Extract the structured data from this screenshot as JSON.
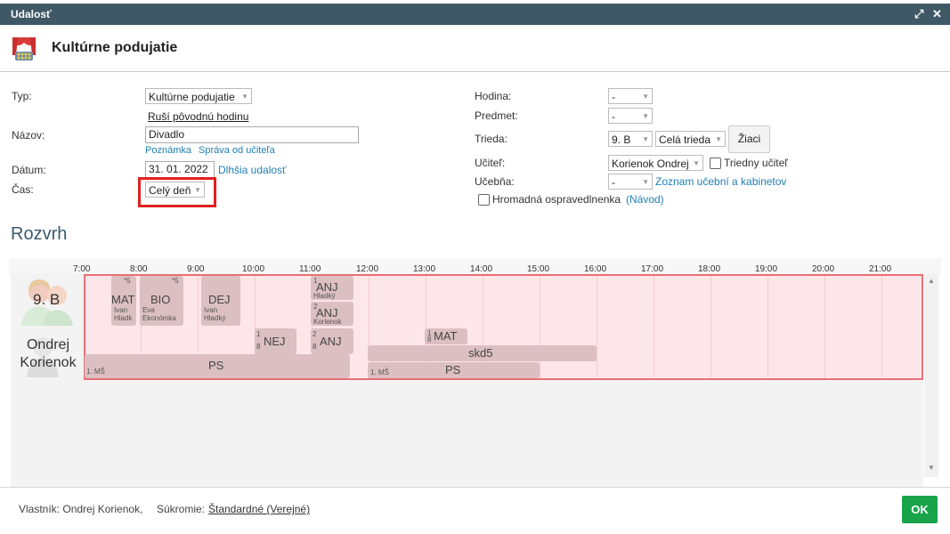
{
  "window": {
    "title": "Udalosť"
  },
  "header": {
    "title": "Kultúrne podujatie"
  },
  "form": {
    "typ_label": "Typ:",
    "typ_value": "Kultúrne podujatie",
    "rusi_link": "Ruší pôvodnú hodinu",
    "nazov_label": "Názov:",
    "nazov_value": "Divadlo",
    "poznamka_link": "Poznámka",
    "sprava_link": "Správa od učiteľa",
    "datum_label": "Dátum:",
    "datum_value": "31. 01. 2022",
    "dlhsia_link": "Dlhšia udalosť",
    "cas_label": "Čas:",
    "cas_value": "Celý deň",
    "hodina_label": "Hodina:",
    "hodina_value": "-",
    "predmet_label": "Predmet:",
    "predmet_value": "-",
    "trieda_label": "Trieda:",
    "trieda_value": "9. B",
    "skupina_value": "Celá trieda",
    "ziaci_button": "Žiaci",
    "ucitel_label": "Učiteľ:",
    "ucitel_value": "Korienok Ondrej",
    "triedny_label": "Triedny učiteľ",
    "ucebna_label": "Učebňa:",
    "ucebna_value": "-",
    "zoznam_link": "Zoznam učební a kabinetov",
    "hromadna_label": "Hromadná ospravedlnenka",
    "navod_link": "(Návod)"
  },
  "schedule": {
    "title": "Rozvrh",
    "times": [
      "7:00",
      "8:00",
      "9:00",
      "10:00",
      "11:00",
      "12:00",
      "13:00",
      "14:00",
      "15:00",
      "16:00",
      "17:00",
      "18:00",
      "19:00",
      "20:00",
      "21:00"
    ],
    "class_label": "9. B",
    "teacher_label_1": "Ondrej",
    "teacher_label_2": "Korienok",
    "blocks": {
      "mat": {
        "name": "MAT",
        "sup": "*5",
        "sub1": "Ivan",
        "sub2": "Hladk"
      },
      "bio": {
        "name": "BIO",
        "sup": "*5",
        "sub1": "Eva",
        "sub2": "Ekonómka"
      },
      "dej": {
        "name": "DEJ",
        "sub1": "Ivan",
        "sub2": "Hladký"
      },
      "anj1": {
        "name": "ANJ",
        "sub1": "1",
        "sub2": "Hladký"
      },
      "anj2": {
        "name": "ANJ",
        "sub1": "2",
        "sub2": "Korienok"
      },
      "nej": {
        "name": "NEJ",
        "sub1": "1",
        "sub2": "8"
      },
      "anj3": {
        "name": "ANJ",
        "sub1": "2",
        "sub2": "8"
      },
      "mat2": {
        "name": "MAT",
        "sub1": "1",
        "sub2": "8"
      },
      "ps1": {
        "name": "PS",
        "sub1": "1. MŠ"
      },
      "skd5": {
        "name": "skd5"
      },
      "ps2": {
        "name": "PS",
        "sub1": "1. MŠ"
      }
    }
  },
  "footer": {
    "owner": "Vlastník: Ondrej Korienok,",
    "privacy_label": "Súkromie:",
    "privacy_value": "Štandardné (Verejné)",
    "ok_button": "OK"
  },
  "colors": {
    "titlebar": "#3f5866",
    "band": "#fde6e9",
    "band_border": "#e87075",
    "block": "#dcbfc2",
    "link": "#1f7fb5",
    "ok": "#19a34a",
    "highlight": "#e02020"
  }
}
